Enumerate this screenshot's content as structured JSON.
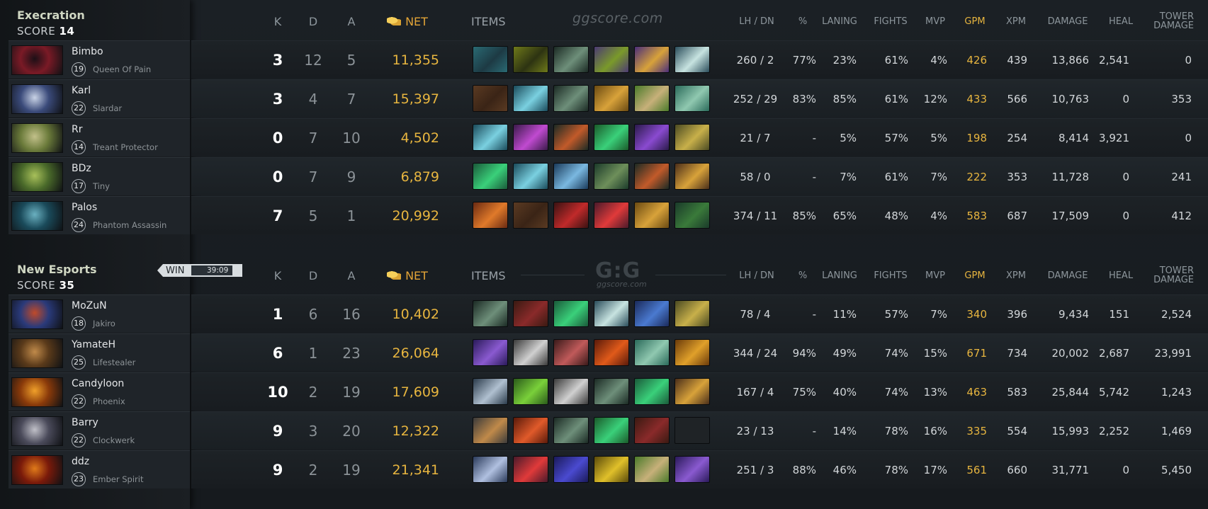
{
  "columns": {
    "k": "K",
    "d": "D",
    "a": "A",
    "net": "NET",
    "items": "ITEMS",
    "lhdn": "LH  /  DN",
    "pct": "%",
    "laning": "LANING",
    "fights": "FIGHTS",
    "mvp": "MVP",
    "gpm": "GPM",
    "xpm": "XPM",
    "damage": "DAMAGE",
    "heal": "HEAL",
    "tower1": "TOWER",
    "tower2": "DAMAGE"
  },
  "watermark": {
    "top": "ggscore.com",
    "logo": "G:G",
    "sub": "ggscore.com"
  },
  "win": {
    "label": "WIN",
    "time": "39:09"
  },
  "teams": [
    {
      "name": "Execration",
      "score_label": "SCORE",
      "score": "14",
      "players": [
        {
          "name": "Bimbo",
          "level": "19",
          "hero": "Queen Of Pain",
          "k": "3",
          "d": "12",
          "a": "5",
          "net": "11,355",
          "lhdn": "260  /  2",
          "pct": "77%",
          "laning": "23%",
          "fights": "61%",
          "mvp": "4%",
          "gpm": "426",
          "xpm": "439",
          "damage": "13,866",
          "heal": "2,541",
          "tower": "0",
          "portrait": [
            "#7a1a26",
            "#1c0f16"
          ],
          "items": [
            [
              "#2a6a73",
              "#1d3a44"
            ],
            [
              "#6f7a1a",
              "#2d3312"
            ],
            [
              "#1b2a24",
              "#6e8f7a"
            ],
            [
              "#4b3a73",
              "#7a9a2a"
            ],
            [
              "#4a2e7a",
              "#d8a23a"
            ],
            [
              "#2a4c5a",
              "#c7e3e0"
            ]
          ]
        },
        {
          "name": "Karl",
          "level": "22",
          "hero": "Slardar",
          "k": "3",
          "d": "4",
          "a": "7",
          "net": "15,397",
          "lhdn": "252  /  29",
          "pct": "83%",
          "laning": "85%",
          "fights": "61%",
          "mvp": "12%",
          "gpm": "433",
          "xpm": "566",
          "damage": "10,763",
          "heal": "0",
          "tower": "353",
          "portrait": [
            "#3a4a7a",
            "#c9d3e6"
          ],
          "items": [
            [
              "#5a3a22",
              "#3a2416"
            ],
            [
              "#1a4a5a",
              "#7ad0e0"
            ],
            [
              "#1b2a24",
              "#6e8f7a"
            ],
            [
              "#6a4a12",
              "#d8a23a"
            ],
            [
              "#4a7a2a",
              "#c7b07a"
            ],
            [
              "#2a6a5a",
              "#90c8b0"
            ]
          ]
        },
        {
          "name": "Rr",
          "level": "14",
          "hero": "Treant Protector",
          "k": "0",
          "d": "7",
          "a": "10",
          "net": "4,502",
          "lhdn": "21  /  7",
          "pct": "-",
          "laning": "5%",
          "fights": "57%",
          "mvp": "5%",
          "gpm": "198",
          "xpm": "254",
          "damage": "8,414",
          "heal": "3,921",
          "tower": "0",
          "portrait": [
            "#6a7a3a",
            "#c2c08a"
          ],
          "items": [
            [
              "#1a4a5a",
              "#7ad0e0"
            ],
            [
              "#3a1a4a",
              "#c04ad0"
            ],
            [
              "#1b2a24",
              "#c25a2a"
            ],
            [
              "#1a5a2a",
              "#3ad07a"
            ],
            [
              "#2a1a4a",
              "#8a4ad0"
            ],
            [
              "#4a4a22",
              "#c8b04a"
            ]
          ]
        },
        {
          "name": "BDz",
          "level": "17",
          "hero": "Tiny",
          "k": "0",
          "d": "7",
          "a": "9",
          "net": "6,879",
          "lhdn": "58  /  0",
          "pct": "-",
          "laning": "7%",
          "fights": "61%",
          "mvp": "7%",
          "gpm": "222",
          "xpm": "353",
          "damage": "11,728",
          "heal": "0",
          "tower": "241",
          "portrait": [
            "#4a6a2a",
            "#a8c05a"
          ],
          "items": [
            [
              "#1a5a3a",
              "#3ad07a"
            ],
            [
              "#1a4a5a",
              "#7ad0e0"
            ],
            [
              "#1a3a5a",
              "#7ab8e0"
            ],
            [
              "#1b3a2a",
              "#6e8f5a"
            ],
            [
              "#1b2a24",
              "#c25a2a"
            ],
            [
              "#4a2e1a",
              "#d8a23a"
            ]
          ]
        },
        {
          "name": "Palos",
          "level": "24",
          "hero": "Phantom Assassin",
          "k": "7",
          "d": "5",
          "a": "1",
          "net": "20,992",
          "lhdn": "374  /  11",
          "pct": "85%",
          "laning": "65%",
          "fights": "48%",
          "mvp": "4%",
          "gpm": "583",
          "xpm": "687",
          "damage": "17,509",
          "heal": "0",
          "tower": "412",
          "portrait": [
            "#1a4a5a",
            "#6ab0c0"
          ],
          "items": [
            [
              "#6a2a12",
              "#e07a2a"
            ],
            [
              "#5a3a22",
              "#3a2416"
            ],
            [
              "#3a1212",
              "#c02a2a"
            ],
            [
              "#4a1a2a",
              "#e03a3a"
            ],
            [
              "#6a4a12",
              "#d8a23a"
            ],
            [
              "#1a3a2a",
              "#3a7a3a"
            ]
          ]
        }
      ]
    },
    {
      "name": "New Esports",
      "score_label": "SCORE",
      "score": "35",
      "players": [
        {
          "name": "MoZuN",
          "level": "18",
          "hero": "Jakiro",
          "k": "1",
          "d": "6",
          "a": "16",
          "net": "10,402",
          "lhdn": "78  /  4",
          "pct": "-",
          "laning": "11%",
          "fights": "57%",
          "mvp": "7%",
          "gpm": "340",
          "xpm": "396",
          "damage": "9,434",
          "heal": "151",
          "tower": "2,524",
          "portrait": [
            "#2a3a7a",
            "#c04a2a"
          ],
          "items": [
            [
              "#1b2a24",
              "#6e8f7a"
            ],
            [
              "#3a1a12",
              "#8a2a2a"
            ],
            [
              "#1a5a3a",
              "#3ad07a"
            ],
            [
              "#2a4c5a",
              "#c7e3e0"
            ],
            [
              "#1a2a5a",
              "#4a7ad0"
            ],
            [
              "#4a4a22",
              "#c8b04a"
            ]
          ]
        },
        {
          "name": "YamateH",
          "level": "25",
          "hero": "Lifestealer",
          "k": "6",
          "d": "1",
          "a": "23",
          "net": "26,064",
          "lhdn": "344  /  24",
          "pct": "94%",
          "laning": "49%",
          "fights": "74%",
          "mvp": "15%",
          "gpm": "671",
          "xpm": "734",
          "damage": "20,002",
          "heal": "2,687",
          "tower": "23,991",
          "portrait": [
            "#5a3a1a",
            "#c08a4a"
          ],
          "items": [
            [
              "#2a1a5a",
              "#8a5ad0"
            ],
            [
              "#3a3a3a",
              "#d0d0d0"
            ],
            [
              "#3a1a1a",
              "#c05a5a"
            ],
            [
              "#5a1a0a",
              "#e05a1a"
            ],
            [
              "#2a6a5a",
              "#90c8b0"
            ],
            [
              "#6a3a0a",
              "#e0a02a"
            ]
          ]
        },
        {
          "name": "Candyloon",
          "level": "22",
          "hero": "Phoenix",
          "k": "10",
          "d": "2",
          "a": "19",
          "net": "17,609",
          "lhdn": "167  /  4",
          "pct": "75%",
          "laning": "40%",
          "fights": "74%",
          "mvp": "13%",
          "gpm": "463",
          "xpm": "583",
          "damage": "25,844",
          "heal": "5,742",
          "tower": "1,243",
          "portrait": [
            "#8a3a0a",
            "#f0a02a"
          ],
          "items": [
            [
              "#2a3a4a",
              "#b0c0d0"
            ],
            [
              "#2a5a1a",
              "#7ad03a"
            ],
            [
              "#3a3a3a",
              "#d0d0d0"
            ],
            [
              "#1b2a24",
              "#6e8f7a"
            ],
            [
              "#1a5a3a",
              "#3ad07a"
            ],
            [
              "#4a2e1a",
              "#d8a23a"
            ]
          ]
        },
        {
          "name": "Barry",
          "level": "22",
          "hero": "Clockwerk",
          "k": "9",
          "d": "3",
          "a": "20",
          "net": "12,322",
          "lhdn": "23  /  13",
          "pct": "-",
          "laning": "14%",
          "fights": "78%",
          "mvp": "16%",
          "gpm": "335",
          "xpm": "554",
          "damage": "15,993",
          "heal": "2,252",
          "tower": "1,469",
          "portrait": [
            "#4a4a5a",
            "#c0c0c8"
          ],
          "items": [
            [
              "#3a3a3a",
              "#c08a4a"
            ],
            [
              "#5a1a0a",
              "#e05a2a"
            ],
            [
              "#1b2a24",
              "#6e8f7a"
            ],
            [
              "#1a5a2a",
              "#3ad07a"
            ],
            [
              "#3a1a12",
              "#8a2a2a"
            ],
            [
              "#1f2326",
              "#1f2326"
            ]
          ]
        },
        {
          "name": "ddz",
          "level": "23",
          "hero": "Ember Spirit",
          "k": "9",
          "d": "2",
          "a": "19",
          "net": "21,341",
          "lhdn": "251  /  3",
          "pct": "88%",
          "laning": "46%",
          "fights": "78%",
          "mvp": "17%",
          "gpm": "561",
          "xpm": "660",
          "damage": "31,771",
          "heal": "0",
          "tower": "5,450",
          "portrait": [
            "#7a1a0a",
            "#e07a1a"
          ],
          "items": [
            [
              "#2a3a5a",
              "#b0c0e0"
            ],
            [
              "#4a1a2a",
              "#e03a3a"
            ],
            [
              "#1a1a5a",
              "#4a4ad0"
            ],
            [
              "#5a4a0a",
              "#e0c02a"
            ],
            [
              "#4a7a2a",
              "#c7b07a"
            ],
            [
              "#2a1a5a",
              "#8a5ad0"
            ]
          ]
        }
      ]
    }
  ]
}
